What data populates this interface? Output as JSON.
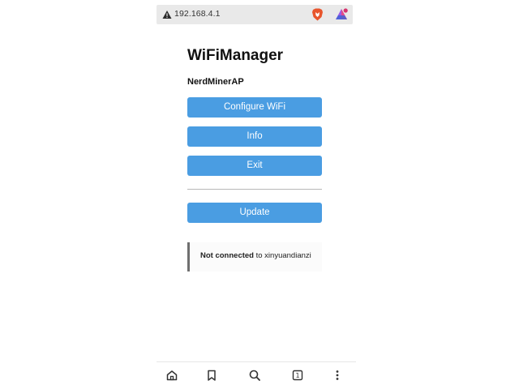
{
  "browser": {
    "address": "192.168.4.1",
    "icons": [
      "warning-icon",
      "brave-lion-icon",
      "prism-triangle-icon"
    ]
  },
  "page": {
    "title": "WiFiManager",
    "subtitle": "NerdMinerAP",
    "buttons": {
      "configure": "Configure WiFi",
      "info": "Info",
      "exit": "Exit",
      "update": "Update"
    },
    "status": {
      "bold": "Not connected",
      "rest": " to xinyuandianzi"
    },
    "colors": {
      "button_bg": "#4a9de2",
      "button_text": "#ffffff",
      "status_border": "#6f6f6f"
    }
  },
  "bottom_nav": {
    "items": [
      "home-icon",
      "bookmark-icon",
      "search-icon",
      "tabs-icon",
      "menu-icon"
    ],
    "tab_count": "1"
  }
}
